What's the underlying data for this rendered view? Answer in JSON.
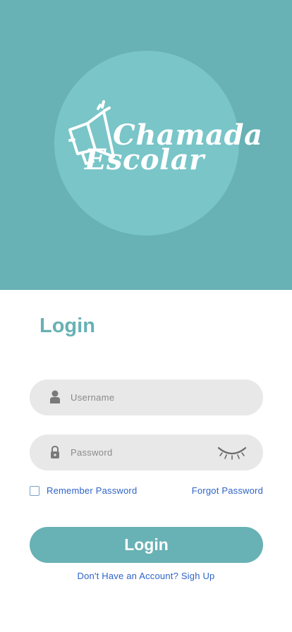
{
  "brand": {
    "logo_line1": "Chamada",
    "logo_line2": "Escolar",
    "colors": {
      "primary": "#68b1b4",
      "circle": "#79c5c8",
      "link": "#2f63c8",
      "field_bg": "#e8e8e8"
    }
  },
  "login": {
    "title": "Login",
    "username_placeholder": "Username",
    "password_placeholder": "Password",
    "remember_label": "Remember Password",
    "forgot_label": "Forgot Password",
    "submit_label": "Login",
    "signup_label": "Don't Have an Account? Sigh Up"
  },
  "icons": {
    "logo": "megaphone-icon",
    "username": "user-icon",
    "password": "lock-icon",
    "toggle_password": "eye-closed-icon"
  }
}
